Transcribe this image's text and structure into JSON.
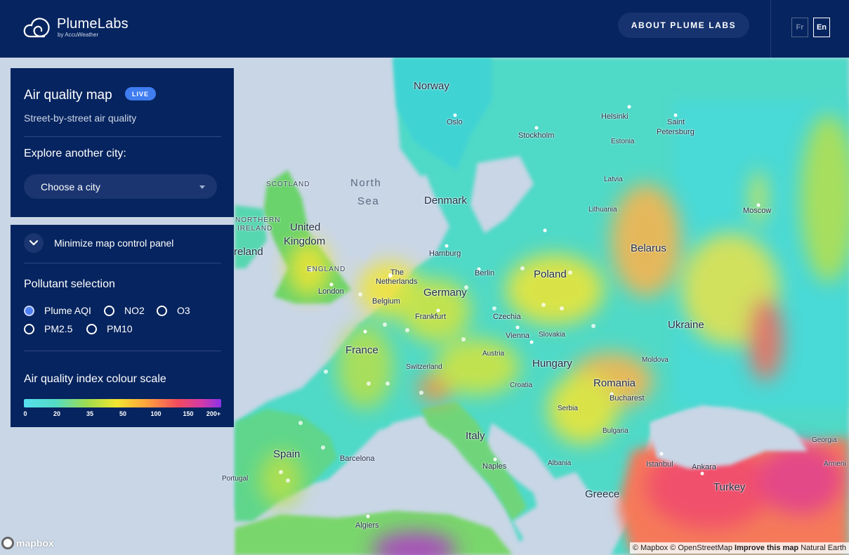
{
  "header": {
    "brand": "PlumeLabs",
    "brand_sub": "by AccuWeather",
    "about_button": "ABOUT PLUME LABS",
    "lang_fr": "Fr",
    "lang_en": "En",
    "active_language": "En"
  },
  "panel": {
    "title": "Air quality map",
    "live_badge": "LIVE",
    "subtitle": "Street-by-street air quality",
    "explore_label": "Explore another city:",
    "city_select_value": "Choose a city",
    "minimize_label": "Minimize map control panel",
    "pollutant_heading": "Pollutant selection",
    "pollutants": [
      {
        "label": "Plume AQI",
        "selected": true
      },
      {
        "label": "NO2",
        "selected": false
      },
      {
        "label": "O3",
        "selected": false
      },
      {
        "label": "PM2.5",
        "selected": false
      },
      {
        "label": "PM10",
        "selected": false
      }
    ],
    "scale_heading": "Air quality index colour scale",
    "scale_ticks": [
      "0",
      "20",
      "35",
      "50",
      "100",
      "150",
      "200+"
    ],
    "scale_colors": [
      "#56e0ef",
      "#53dcc4",
      "#9fdc4e",
      "#f2e530",
      "#ffa33c",
      "#f24b5e",
      "#d43aa8",
      "#8a33e8"
    ]
  },
  "map": {
    "labels": {
      "norway": "Norway",
      "oslo": "Oslo",
      "stockholm": "Stockholm",
      "helsinki": "Helsinki",
      "saint_petersburg_1": "Saint",
      "saint_petersburg_2": "Petersburg",
      "estonia": "Estonia",
      "latvia": "Latvia",
      "lithuania": "Lithuania",
      "moscow": "Moscow",
      "north_sea_1": "North",
      "north_sea_2": "Sea",
      "denmark": "Denmark",
      "scotland": "SCOTLAND",
      "northern_ireland_1": "NORTHERN",
      "northern_ireland_2": "IRELAND",
      "ireland": "reland",
      "uk_1": "United",
      "uk_2": "Kingdom",
      "england": "ENGLAND",
      "london": "London",
      "hamburg": "Hamburg",
      "berlin": "Berlin",
      "netherlands_1": "The",
      "netherlands_2": "Netherlands",
      "belgium": "Belgium",
      "germany": "Germany",
      "poland": "Poland",
      "belarus": "Belarus",
      "frankfurt": "Frankfurt",
      "czechia": "Czechia",
      "ukraine": "Ukraine",
      "vienna": "Vienna",
      "slovakia": "Slovakia",
      "france": "France",
      "austria": "Austria",
      "switzerland": "Switzerland",
      "hungary": "Hungary",
      "moldova": "Moldova",
      "romania": "Romania",
      "croatia": "Croatia",
      "bucharest": "Bucharest",
      "serbia": "Serbia",
      "bulgaria": "Bulgaria",
      "italy": "Italy",
      "spain": "Spain",
      "barcelona": "Barcelona",
      "portugal": "Portugal",
      "naples": "Naples",
      "albania": "Albania",
      "istanbul": "Istanbul",
      "ankara": "Ankara",
      "turkey": "Turkey",
      "georgia": "Georgia",
      "armenia": "Armeni",
      "greece": "Greece",
      "algiers": "Algiers"
    },
    "mapbox_logo": "mapbox",
    "attribution_1": "© Mapbox © OpenStreetMap",
    "attribution_2": "Improve this map",
    "attribution_3": "Natural Earth"
  }
}
